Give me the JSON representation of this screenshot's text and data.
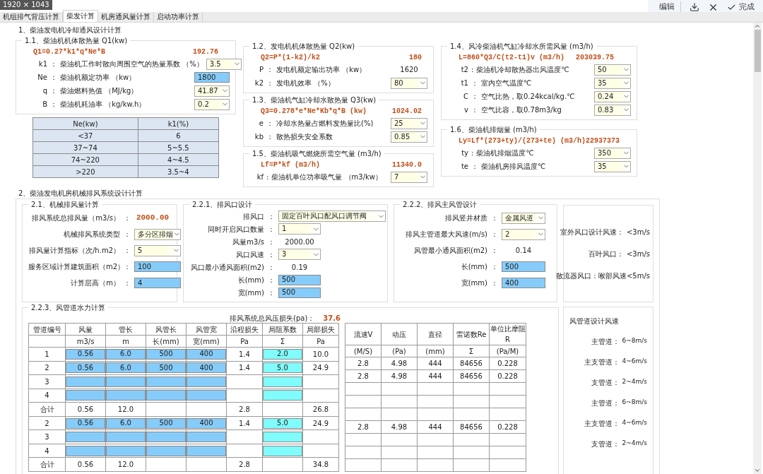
{
  "topbar": {
    "size_badge": "1920 × 1043",
    "actions": [
      {
        "kind": "text",
        "label": "编辑"
      },
      {
        "kind": "download"
      },
      {
        "kind": "close"
      },
      {
        "kind": "done",
        "label": "完成"
      }
    ]
  },
  "tabs": [
    {
      "label": "机组排气背压计算",
      "selected": false
    },
    {
      "label": "柴发计算",
      "selected": true
    },
    {
      "label": "机房通风量计算",
      "selected": false
    },
    {
      "label": "启动功率计算",
      "selected": false
    }
  ],
  "section1": {
    "title": "1、柴油发电机冷却通风设计计算",
    "q1": {
      "title": "1.1、柴油机机体散热量  Q1(kw)",
      "formula": "Q1=0.27*k1*q*Ne*B",
      "result": "192.76",
      "rows": [
        {
          "symbol": "k1",
          "sep": "：",
          "label": "柴油机工作时散向周围空气的热量系数 （%）",
          "kind": "select",
          "value": "3.5"
        },
        {
          "symbol": "Ne",
          "sep": "：",
          "label": "柴油机额定功率 （kw）",
          "kind": "input",
          "value": "1800"
        },
        {
          "symbol": "q",
          "sep": "：",
          "label": "柴油燃料热值 （MJ/kg）",
          "kind": "select",
          "value": "41.87"
        },
        {
          "symbol": "B",
          "sep": "：",
          "label": "柴油机耗油率 （kg/kw.h）",
          "kind": "select",
          "value": "0.2"
        }
      ],
      "table": {
        "columns": [
          "Ne(kw)",
          "k1(%)"
        ],
        "rows": [
          [
            "<37",
            "6"
          ],
          [
            "37~74",
            "5~5.5"
          ],
          [
            "74~220",
            "4~4.5"
          ],
          [
            ">220",
            "3.5~4"
          ]
        ]
      }
    },
    "q2": {
      "title": "1.2、发电机机体散热量  Q2(kw)",
      "formula": "Q2=P*(1-k2)/k2",
      "result": "180",
      "rows": [
        {
          "symbol": "P",
          "sep": "：",
          "label": "发电机额定输出功率 （kw）",
          "kind": "value",
          "value": "1620"
        },
        {
          "symbol": "k2",
          "sep": "：",
          "label": "发电机效率 （%）",
          "kind": "select",
          "value": "80"
        }
      ]
    },
    "q3": {
      "title": "1.3、柴油机气缸冷却水散热量  Q3(kw)",
      "formula": "Q3=0.278*e*Ne*Kb*q*B  (kw)",
      "result": "1024.02",
      "rows": [
        {
          "symbol": "e",
          "sep": "：",
          "label": "冷却水热量占燃料发热量比(%)",
          "kind": "select",
          "value": "25"
        },
        {
          "symbol": "kb",
          "sep": "：",
          "label": "散热损失安全系数",
          "kind": "select",
          "value": "0.85"
        }
      ]
    },
    "lf": {
      "title": "1.5、柴油机吸气燃烧所需空气量  (m3/h)",
      "formula": "Lf=P*kf  (m3/h)",
      "result": "11340.0",
      "rows": [
        {
          "symbol": "kf",
          "sep": ":",
          "label": "柴油机单位功率吸气量 （m3/kw）",
          "kind": "select",
          "value": "7"
        }
      ]
    },
    "l": {
      "title": "1.4、风冷柴油机气缸冷却水所需风量  (m3/h)",
      "formula": "L=860*Q3/C(t2-t1)v  (m3/h)",
      "result": "203039.75",
      "rows": [
        {
          "symbol": "t2",
          "sep": ":",
          "label": "柴油机冷却散热器出风温度℃",
          "kind": "select",
          "value": "50"
        },
        {
          "symbol": "t1",
          "sep": "：",
          "label": "室内空气温度℃",
          "kind": "select",
          "value": "35"
        },
        {
          "symbol": "C",
          "sep": "：",
          "label": "空气比热，取0.24kcal/kg.℃",
          "kind": "select",
          "value": "0.24"
        },
        {
          "symbol": "v",
          "sep": "：",
          "label": "空气比容，取0.78m3/kg",
          "kind": "select",
          "value": "0.83"
        }
      ]
    },
    "ly": {
      "title": "1.6、柴油机排烟量  (m3/h)",
      "formula": "Ly=Lf*(273+ty)/(273+te)  (m3/h)",
      "result": "22937373",
      "rows": [
        {
          "symbol": "ty",
          "sep": ":",
          "label": "柴油机排烟温度℃",
          "kind": "select",
          "value": "350"
        },
        {
          "symbol": "te",
          "sep": "：",
          "label": "柴油机房排风温度℃",
          "kind": "select",
          "value": "35"
        }
      ]
    }
  },
  "section2": {
    "title": "2、柴油发电机房机械排风系统设计计算",
    "exhaust": {
      "title": "2.1、机械排风量计算",
      "rows": [
        {
          "label": "排风系统总排风量（m3/s）",
          "sep": "：",
          "kind": "result",
          "value": "2000.00"
        },
        {
          "label": "机械排风系统类型",
          "sep": "：",
          "kind": "select",
          "value": "多分区排烟"
        },
        {
          "label": "排风量计算指标（次/h.m2）",
          "sep": "：",
          "kind": "select",
          "value": "5"
        },
        {
          "label": "服务区域计算建筑面积（m2）",
          "sep": "：",
          "kind": "input",
          "value": "100"
        },
        {
          "label": "计算层高（m）",
          "sep": "：",
          "kind": "input",
          "value": "4"
        }
      ]
    },
    "outlet": {
      "title": "2.2.1、排风口设计",
      "rows": [
        {
          "label": "排风口",
          "sep": "：",
          "kind": "select_wide",
          "value": "固定百叶风口配风口调节阀"
        },
        {
          "label": "同时开启风口数量",
          "sep": "：",
          "kind": "select",
          "value": "1"
        },
        {
          "label": "风量m3/s",
          "sep": "：",
          "kind": "value",
          "value": "2000.00"
        },
        {
          "label": "风口风速",
          "sep": "：",
          "kind": "select",
          "value": "3"
        },
        {
          "label": "风口最小通风面积(m2)",
          "sep": "：",
          "kind": "value",
          "value": "0.19"
        },
        {
          "label": "长(mm)",
          "sep": "：",
          "kind": "input",
          "value": "500"
        },
        {
          "label": "宽(mm)",
          "sep": "：",
          "kind": "input",
          "value": "500"
        }
      ]
    },
    "main_duct": {
      "title": "2.2.2、排风主风管设计",
      "rows": [
        {
          "label": "排风竖井材质",
          "sep": "：",
          "kind": "select",
          "value": "金属风道"
        },
        {
          "label": "排风主管道最大风速(m/s)",
          "sep": "：",
          "kind": "select",
          "value": "2"
        },
        {
          "label": "风管最小通风面积(m2)",
          "sep": "：",
          "kind": "value",
          "value": "0.14"
        },
        {
          "label": "长(mm)",
          "sep": "：",
          "kind": "input",
          "value": "500"
        },
        {
          "label": "宽(mm)",
          "sep": "：",
          "kind": "input",
          "value": "400"
        }
      ]
    },
    "notes": [
      {
        "label": "室外风口设计风速：",
        "value": "<3m/s"
      },
      {
        "label": "百叶风口：",
        "value": "<3m/s"
      },
      {
        "label": "散流器风口：喉部风速<5m/s"
      }
    ],
    "hydraulic": {
      "title": "2.2.3、风管道水力计算",
      "total_label": "排风系统总风压损失(pa)：",
      "total_value": "37.6",
      "left_columns": [
        {
          "name": "管道编号"
        },
        {
          "name": "风量",
          "unit": "m3/s"
        },
        {
          "name": "管长",
          "unit": "m"
        },
        {
          "name": "风管长",
          "unit": "长(mm)"
        },
        {
          "name": "风管宽",
          "unit": "宽(mm)"
        },
        {
          "name": "沿程损失",
          "unit": "Pa"
        },
        {
          "name": "局阻系数",
          "unit": "Σ"
        },
        {
          "name": "局部损失",
          "unit": "Pa"
        }
      ],
      "right_columns": [
        {
          "name": "流速V",
          "unit": "(M/S)"
        },
        {
          "name": "动压",
          "unit": "(Pa)"
        },
        {
          "name": "直径",
          "unit": "(mm)"
        },
        {
          "name": "雷诺数Re",
          "unit": "Σ"
        },
        {
          "name": "单位比摩阻R",
          "unit": "(Pa/M)"
        }
      ],
      "rows": [
        {
          "kind": "pipe",
          "id": "1",
          "flow": "0.56",
          "length": "6.0",
          "dlen": "500",
          "dwid": "400",
          "friction": "1.4",
          "coef": "2.0",
          "local": "10.0",
          "v": "2.8",
          "dp": "4.98",
          "dia": "444",
          "re": "84656",
          "r": "0.228"
        },
        {
          "kind": "pipe",
          "id": "2",
          "flow": "0.56",
          "length": "6.0",
          "dlen": "500",
          "dwid": "400",
          "friction": "1.4",
          "coef": "5.0",
          "local": "24.9",
          "v": "2.8",
          "dp": "4.98",
          "dia": "444",
          "re": "84656",
          "r": "0.228"
        },
        {
          "kind": "pipe",
          "id": "3"
        },
        {
          "kind": "pipe",
          "id": "4"
        },
        {
          "kind": "total",
          "id": "合计",
          "flow": "0.56",
          "length": "12.0",
          "friction": "2.8",
          "local": "26.8"
        },
        {
          "kind": "pipe",
          "id": "2",
          "flow": "0.56",
          "length": "6.0",
          "dlen": "500",
          "dwid": "400",
          "friction": "1.4",
          "coef": "5.0",
          "local": "24.9",
          "v": "2.8",
          "dp": "4.98",
          "dia": "444",
          "re": "84656",
          "r": "0.228"
        },
        {
          "kind": "pipe",
          "id": "3"
        },
        {
          "kind": "pipe",
          "id": "4"
        },
        {
          "kind": "total",
          "id": "合计",
          "flow": "0.56",
          "length": "12.0",
          "friction": "2.8",
          "local": "34.8"
        }
      ],
      "speeds_title": "风管道设计风速",
      "speeds": [
        {
          "label": "主管道：",
          "value": "6~8m/s"
        },
        {
          "label": "主支管道：",
          "value": "4~6m/s"
        },
        {
          "label": "支管道：",
          "value": "2~4m/s"
        },
        {
          "label": "主管道：",
          "value": "6~8m/s"
        },
        {
          "label": "主支管道：",
          "value": "4~6m/s"
        },
        {
          "label": "支管道：",
          "value": "2~4m/s"
        }
      ]
    }
  }
}
